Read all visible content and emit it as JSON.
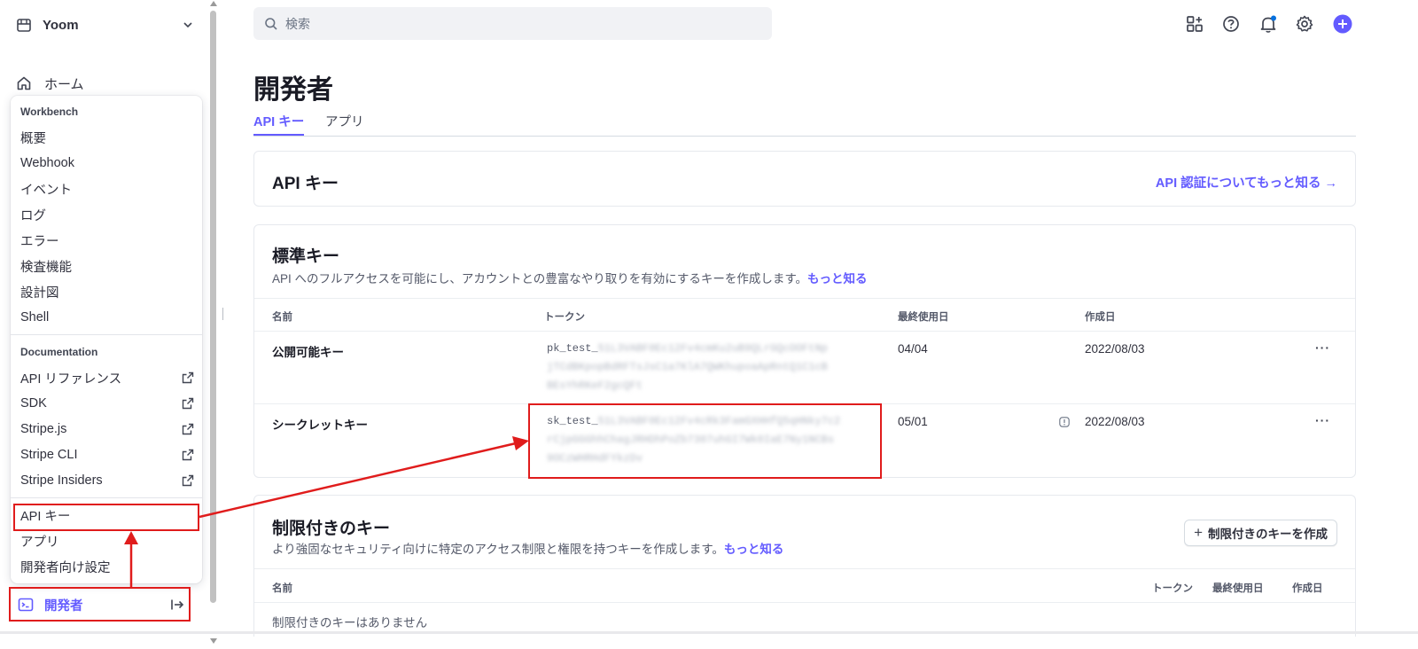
{
  "account": {
    "name": "Yoom"
  },
  "nav": {
    "home_label": "ホーム"
  },
  "search": {
    "placeholder": "検索"
  },
  "flyout": {
    "workbench_title": "Workbench",
    "workbench_items": [
      "概要",
      "Webhook",
      "イベント",
      "ログ",
      "エラー",
      "検査機能",
      "設計図",
      "Shell"
    ],
    "documentation_title": "Documentation",
    "documentation_items": [
      "API リファレンス",
      "SDK",
      "Stripe.js",
      "Stripe CLI",
      "Stripe Insiders"
    ],
    "developer_items": [
      "API キー",
      "アプリ",
      "開発者向け設定"
    ]
  },
  "developer_nav": {
    "label": "開発者"
  },
  "page": {
    "title": "開発者",
    "tabs": [
      "API キー",
      "アプリ"
    ]
  },
  "api_keys_card": {
    "title": "API キー",
    "link": "API 認証についてもっと知る →"
  },
  "standard_keys": {
    "title": "標準キー",
    "description": "API へのフルアクセスを可能にし、アカウントとの豊富なやり取りを有効にするキーを作成します。",
    "more_link": "もっと知る",
    "columns": [
      "名前",
      "トークン",
      "最終使用日",
      "作成日"
    ],
    "rows": [
      {
        "name": "公開可能キー",
        "token_prefix": "pk_test_",
        "token_masked": [
          "51L3VABF0Ec12Fv4cmKu2uB9QLrGQcOOFtNp",
          "jTCdBKpopBdRFTsJsC1a7KlA7QWKhupoaApRntQ1C1cB",
          "BEsYhRKeF2gcQFt"
        ],
        "last_used": "04/04",
        "created": "2022/08/03"
      },
      {
        "name": "シークレットキー",
        "token_prefix": "sk_test_",
        "token_masked": [
          "51L3VABF0Ec12Fv4cRk3FamGXHHfQ5qHNky7c2",
          "rCjpGGGhhChagJRHDhPoZb7307uhGI7Wk0IaE7Ny1NCBs",
          "9OCzWHRHdFYkzDv"
        ],
        "last_used": "05/01",
        "created": "2022/08/03"
      }
    ],
    "row_menu": "···"
  },
  "restricted_keys": {
    "title": "制限付きのキー",
    "description": "より強固なセキュリティ向けに特定のアクセス制限と権限を持つキーを作成します。",
    "more_link": "もっと知る",
    "create_button": "制限付きのキーを作成",
    "columns": [
      "名前",
      "トークン",
      "最終使用日",
      "作成日"
    ],
    "empty_text": "制限付きのキーはありません"
  },
  "colors": {
    "accent": "#635bff",
    "annotation": "#e01c1c",
    "notification_dot": "#0570de"
  },
  "icons": [
    "store-icon",
    "chevron-down-icon",
    "home-icon",
    "search-icon",
    "apps-icon",
    "help-icon",
    "bell-icon",
    "gear-icon",
    "plus-icon",
    "external-link-icon",
    "terminal-icon",
    "collapse-icon",
    "info-icon"
  ]
}
